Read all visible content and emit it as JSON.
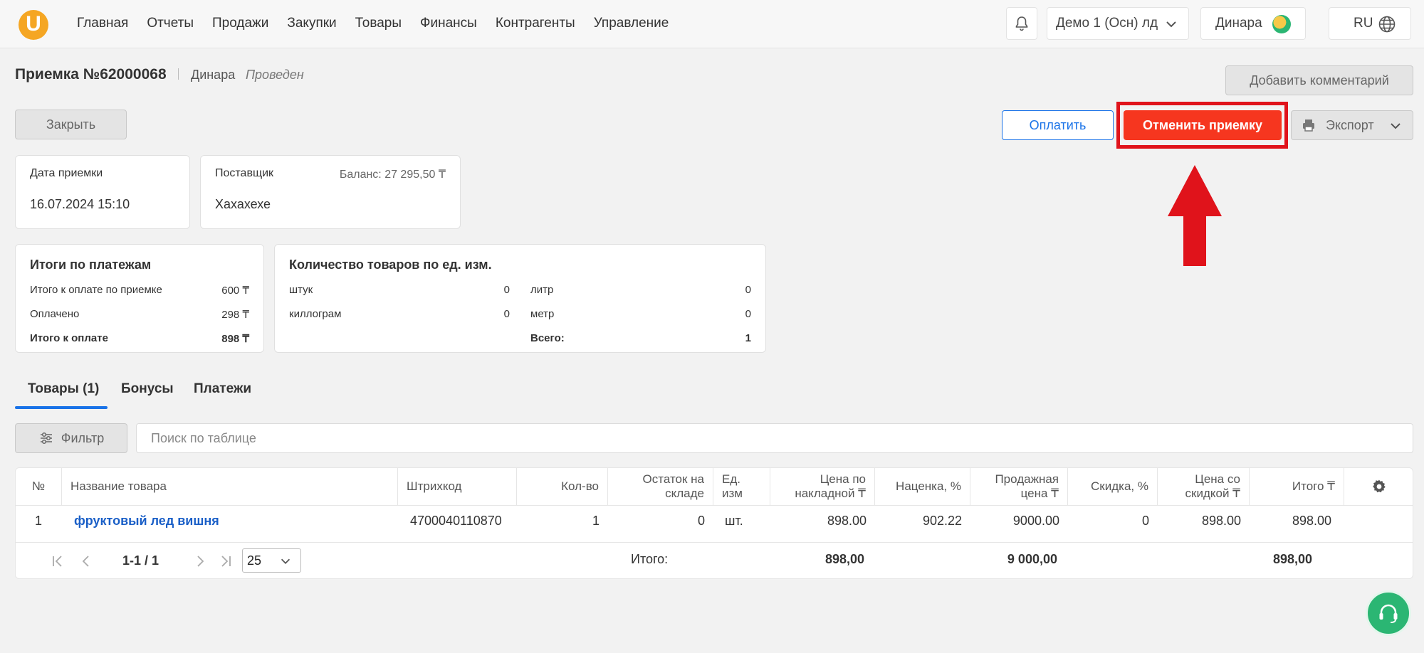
{
  "header": {
    "logo_letter": "U",
    "nav": [
      "Главная",
      "Отчеты",
      "Продажи",
      "Закупки",
      "Товары",
      "Финансы",
      "Контрагенты",
      "Управление"
    ],
    "org": "Демо 1 (Осн) лд",
    "user": "Динара",
    "lang": "RU"
  },
  "doc": {
    "title": "Приемка №62000068",
    "author": "Динара",
    "status": "Проведен",
    "add_comment": "Добавить комментарий",
    "close": "Закрыть",
    "pay": "Оплатить",
    "cancel": "Отменить приемку",
    "export": "Экспорт"
  },
  "cards": {
    "date_label": "Дата приемки",
    "date_value": "16.07.2024 15:10",
    "supplier_label": "Поставщик",
    "balance": "Баланс: 27 295,50 ₸",
    "supplier_value": "Хахахехе",
    "payments": {
      "title": "Итоги по платежам",
      "rows": [
        {
          "label": "Итого к оплате по приемке",
          "value": "600 ₸"
        },
        {
          "label": "Оплачено",
          "value": "298 ₸"
        },
        {
          "label": "Итого к оплате",
          "value": "898 ₸"
        }
      ]
    },
    "quantity": {
      "title": "Количество товаров по ед. изм.",
      "left": [
        {
          "label": "штук",
          "value": "0"
        },
        {
          "label": "киллограм",
          "value": "0"
        }
      ],
      "right": [
        {
          "label": "литр",
          "value": "0"
        },
        {
          "label": "метр",
          "value": "0"
        },
        {
          "label": "Всего:",
          "value": "1"
        }
      ]
    }
  },
  "tabs": [
    "Товары (1)",
    "Бонусы",
    "Платежи"
  ],
  "filter": {
    "button": "Фильтр",
    "search_placeholder": "Поиск по таблице"
  },
  "table": {
    "columns": [
      "№",
      "Название товара",
      "Штрихкод",
      "Кол-во",
      "Остаток на складе",
      "Ед. изм",
      "Цена по накладной ₸",
      "Наценка, %",
      "Продажная цена ₸",
      "Скидка, %",
      "Цена со скидкой ₸",
      "Итого ₸"
    ],
    "rows": [
      [
        "1",
        "фруктовый лед вишня",
        "4700040110870",
        "1",
        "0",
        "шт.",
        "898.00",
        "902.22",
        "9000.00",
        "0",
        "898.00",
        "898.00"
      ]
    ],
    "footer": {
      "label": "Итого:",
      "invoice_total": "898,00",
      "sale_total": "9 000,00",
      "grand_total": "898,00"
    },
    "pagination": {
      "info": "1-1 / 1",
      "page_size": "25"
    }
  },
  "colors": {
    "accent_blue": "#1a73e8",
    "cancel_red": "#f6361f",
    "highlight_red": "#e0131b",
    "logo_orange": "#f5a623",
    "support_green": "#2bb673"
  }
}
